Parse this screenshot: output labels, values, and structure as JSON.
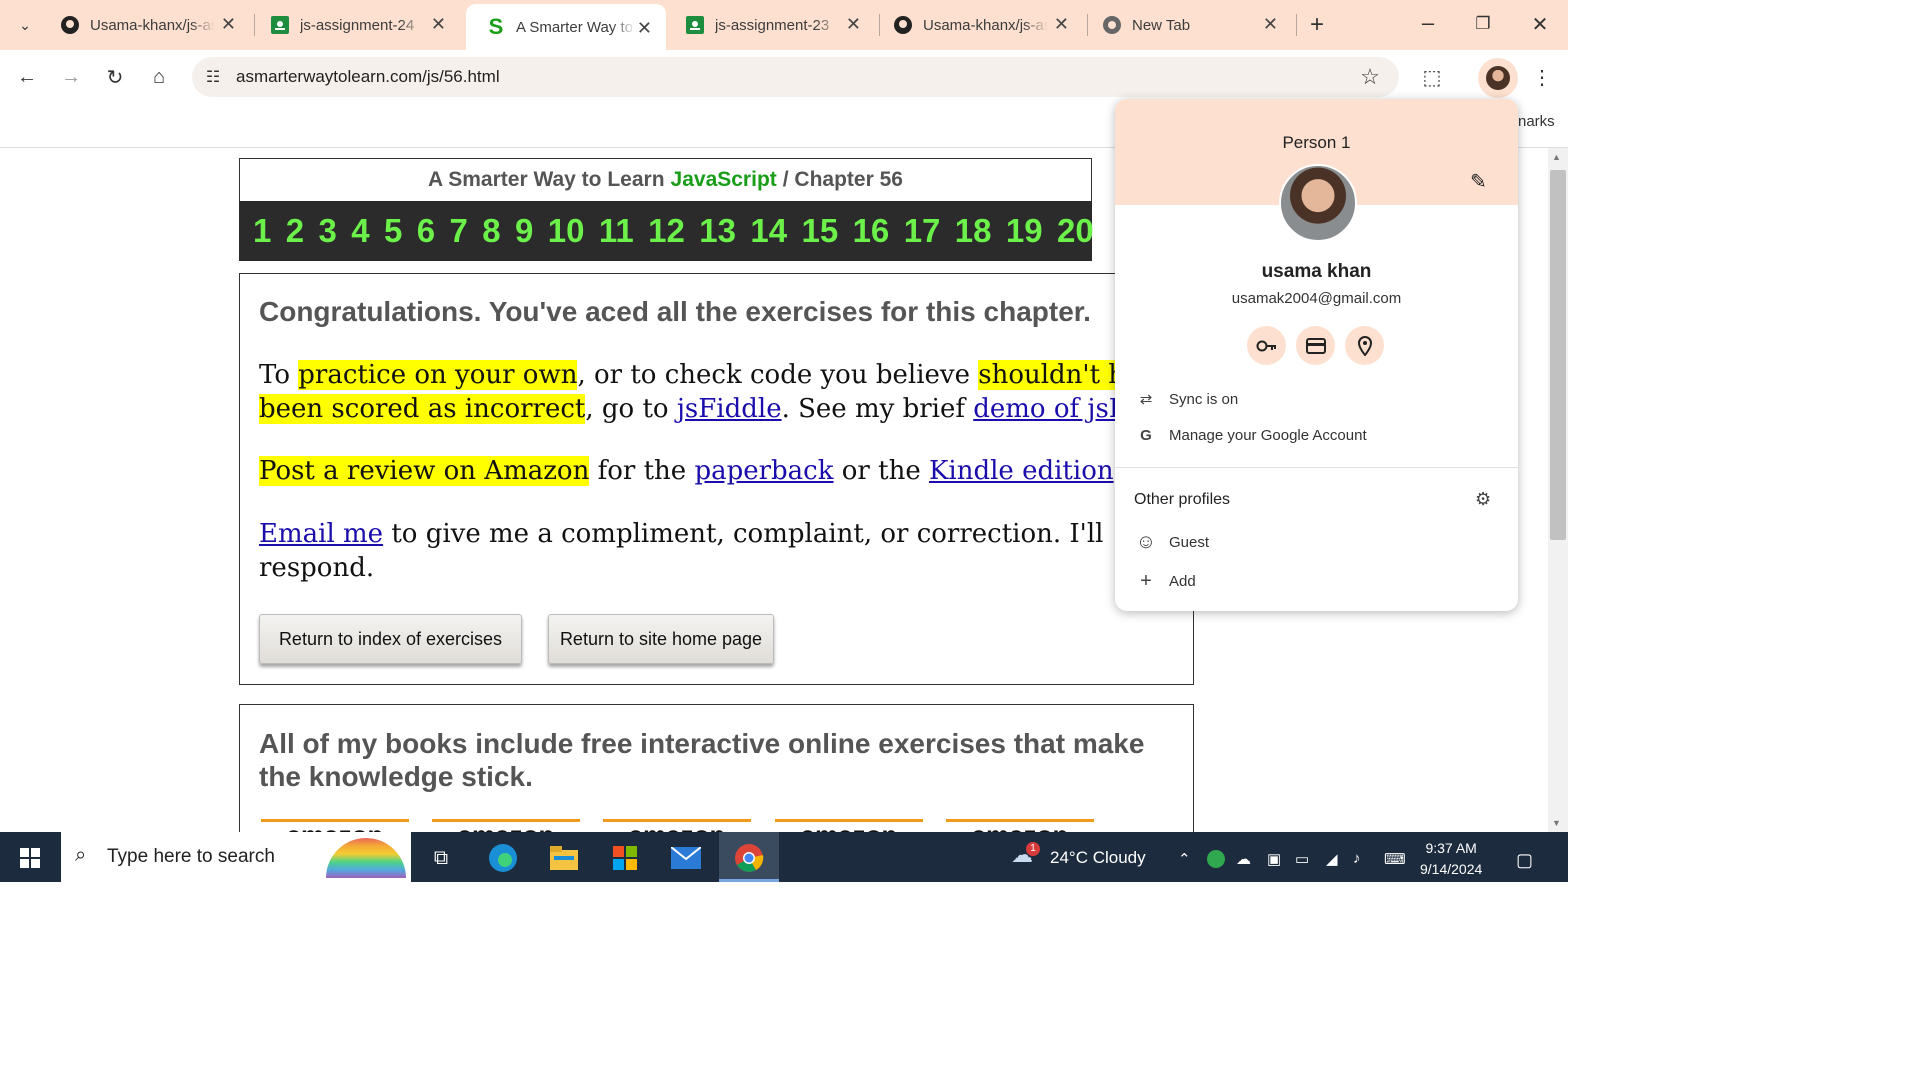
{
  "browser": {
    "tabs": [
      {
        "title": "Usama-khanx/js-as",
        "icon": "github-icon"
      },
      {
        "title": "js-assignment-24",
        "icon": "google-classroom-icon"
      },
      {
        "title": "A Smarter Way to L",
        "icon": "smarter-way-icon",
        "active": true
      },
      {
        "title": "js-assignment-23",
        "icon": "google-classroom-icon"
      },
      {
        "title": "Usama-khanx/js-as",
        "icon": "github-icon"
      },
      {
        "title": "New Tab",
        "icon": "chrome-icon"
      }
    ],
    "url": "asmarterwaytolearn.com/js/56.html",
    "bookmarks_partial": "narks"
  },
  "page": {
    "header_prefix": "A Smarter Way to Learn",
    "header_js": "JavaScript",
    "header_suffix": "/  Chapter 56",
    "chapters": [
      "1",
      "2",
      "3",
      "4",
      "5",
      "6",
      "7",
      "8",
      "9",
      "10",
      "11",
      "12",
      "13",
      "14",
      "15",
      "16",
      "17",
      "18",
      "19",
      "20"
    ],
    "congrats": "Congratulations. You've aced all the exercises for this chapter.",
    "p1": {
      "a": "To ",
      "b": "practice on your own",
      "c": ", or to check code you believe ",
      "d": "shouldn't have",
      "e": "been scored as incorrect",
      "f": ", go to ",
      "g": "jsFiddle",
      "h": ". See my brief ",
      "i": "demo of jsFiddle"
    },
    "p2": {
      "a": "Post a review on Amazon",
      "b": " for the ",
      "c": "paperback",
      "d": " or the ",
      "e": "Kindle edition",
      "f": "."
    },
    "p3": {
      "a": "Email me",
      "b": " to give me a compliment, complaint, or correction. I'll",
      "c": "respond."
    },
    "buttons": {
      "index": "Return to index of exercises",
      "home": "Return to site home page"
    },
    "books_text": "All of my books include free interactive online exercises that make the knowledge stick.",
    "amazon_label": "amazon"
  },
  "profile": {
    "header": "Person 1",
    "name": "usama khan",
    "email": "usamak2004@gmail.com",
    "sync": "Sync is on",
    "manage": "Manage your Google Account",
    "other_profiles": "Other profiles",
    "guest": "Guest",
    "add": "Add"
  },
  "taskbar": {
    "search_placeholder": "Type here to search",
    "weather": "24°C  Cloudy",
    "weather_badge": "1",
    "time": "9:37 AM",
    "date": "9/14/2024"
  }
}
